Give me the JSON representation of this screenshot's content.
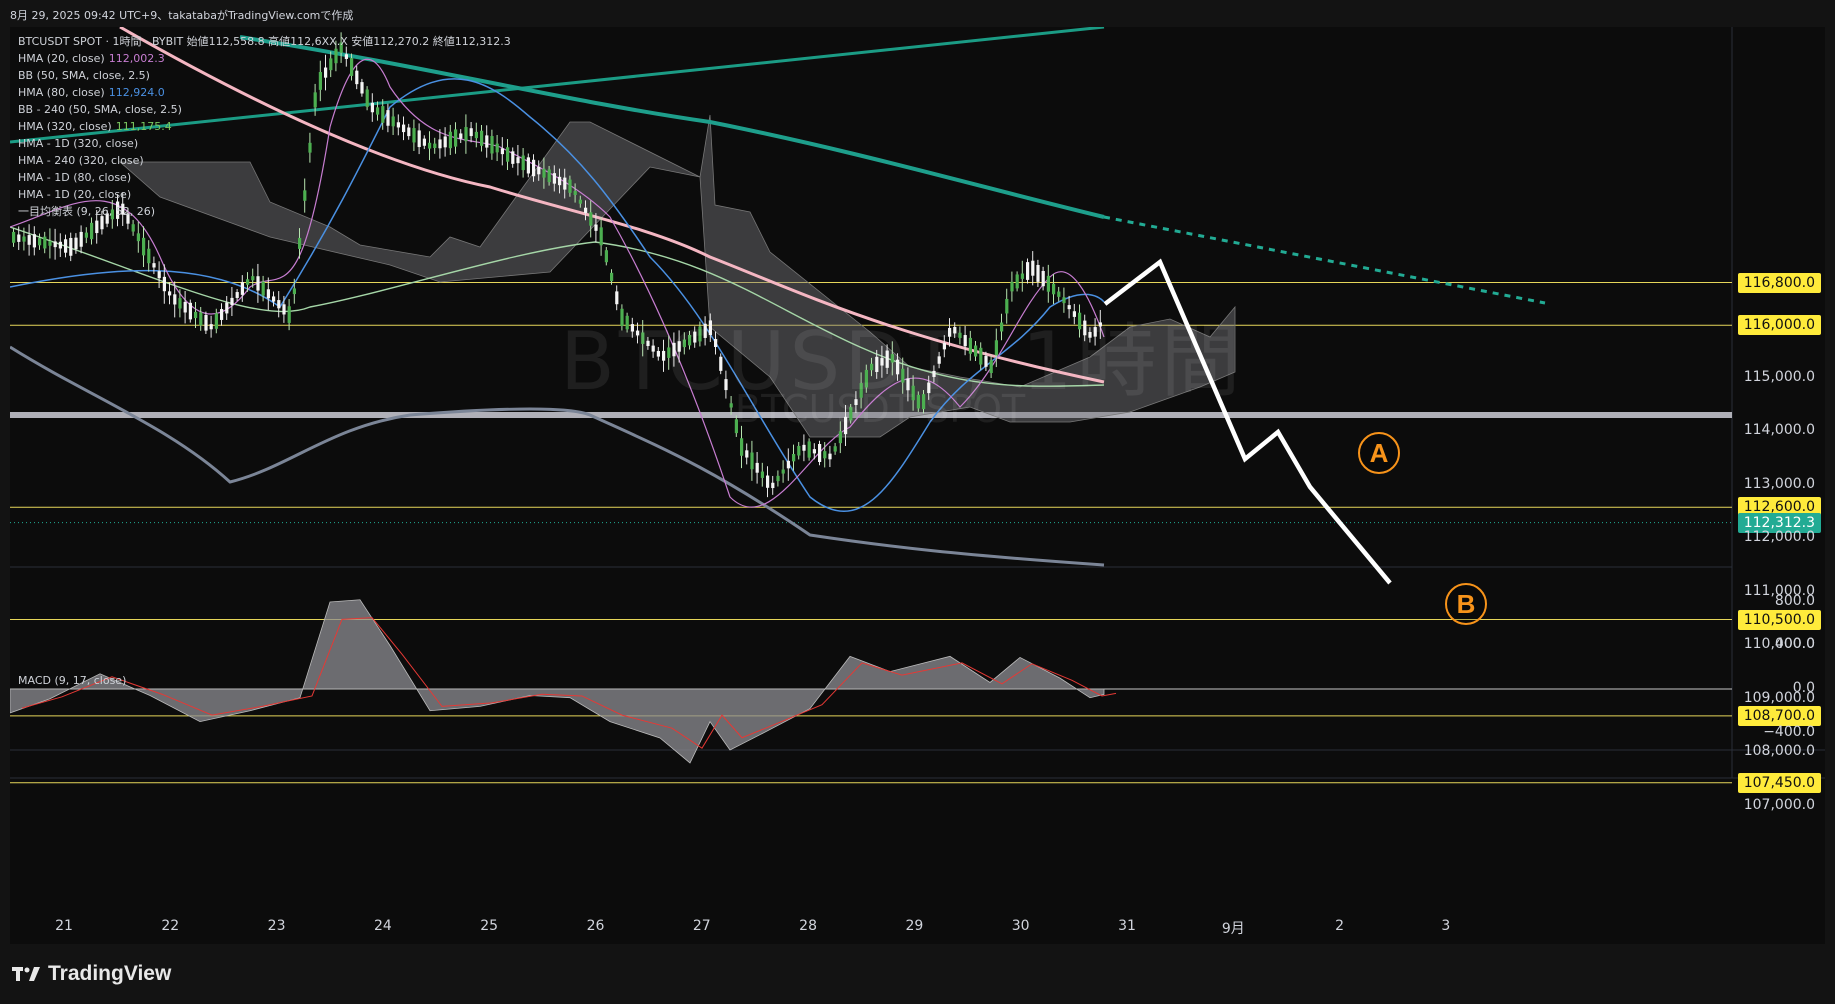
{
  "header": {
    "text": "8月 29, 2025 09:42 UTC+9、takatabaがTradingView.comで作成"
  },
  "legend": {
    "symbol": "BTCUSDT SPOT · 1時間 · BYBIT",
    "open_label": "始値",
    "open": "112,558.8",
    "high_label": "高値",
    "high": "112,6XX.X",
    "low_label": "安値",
    "low": "112,270.2",
    "close_label": "終値",
    "close": "112,312.3",
    "indicators": [
      {
        "label": "HMA (20, close)",
        "value": "112,002.3",
        "color": "#c77dd1"
      },
      {
        "label": "BB (50, SMA, close, 2.5)",
        "value": "",
        "color": "#cfd2d8"
      },
      {
        "label": "HMA (80, close)",
        "value": "112,924.0",
        "color": "#4a90e2"
      },
      {
        "label": "BB - 240 (50, SMA, close, 2.5)",
        "value": "",
        "color": "#cfd2d8"
      },
      {
        "label": "HMA (320, close)",
        "value": "111,175.4",
        "color": "#7ac860"
      },
      {
        "label": "HMA - 1D (320, close)",
        "value": "",
        "color": "#cfd2d8"
      },
      {
        "label": "HMA - 240 (320, close)",
        "value": "",
        "color": "#cfd2d8"
      },
      {
        "label": "HMA - 1D (80, close)",
        "value": "",
        "color": "#cfd2d8"
      },
      {
        "label": "HMA - 1D (20, close)",
        "value": "",
        "color": "#cfd2d8"
      },
      {
        "label": "一目均衡表 (9, 26, 52, 26)",
        "value": "",
        "color": "#cfd2d8"
      }
    ]
  },
  "watermark": {
    "main": "BTCUSDT, 1時間",
    "sub": "BTCUSDT SPOT"
  },
  "price_labels": [
    {
      "text": "116,800.0",
      "price": 116800,
      "style": "yel"
    },
    {
      "text": "116,000.0",
      "price": 116000,
      "style": "yel"
    },
    {
      "text": "115,000.0",
      "price": 115000,
      "style": "plain"
    },
    {
      "text": "114,000.0",
      "price": 114000,
      "style": "plain"
    },
    {
      "text": "113,000.0",
      "price": 113000,
      "style": "plain"
    },
    {
      "text": "112,600.0",
      "price": 112600,
      "style": "yel"
    },
    {
      "text": "112,312.3",
      "price": 112312.3,
      "style": "grn"
    },
    {
      "text": "112,000.0",
      "price": 112000,
      "style": "plain"
    },
    {
      "text": "111,000.0",
      "price": 111000,
      "style": "plain"
    },
    {
      "text": "110,500.0",
      "price": 110500,
      "style": "yel"
    },
    {
      "text": "110,000.0",
      "price": 110000,
      "style": "plain"
    },
    {
      "text": "109,000.0",
      "price": 109000,
      "style": "plain"
    },
    {
      "text": "108,700.0",
      "price": 108700,
      "style": "yel"
    },
    {
      "text": "108,000.0",
      "price": 108000,
      "style": "plain"
    },
    {
      "text": "107,450.0",
      "price": 107450,
      "style": "yel"
    },
    {
      "text": "107,000.0",
      "price": 107000,
      "style": "plain"
    }
  ],
  "macd": {
    "label": "MACD (9, 17, close)",
    "axis": [
      {
        "text": "800.0",
        "v": 800
      },
      {
        "text": "400.0",
        "v": 400
      },
      {
        "text": "0.0",
        "v": 0
      },
      {
        "text": "−400.0",
        "v": -400
      }
    ]
  },
  "x_axis": [
    "21",
    "22",
    "23",
    "24",
    "25",
    "26",
    "27",
    "28",
    "29",
    "30",
    "31",
    "9月",
    "2",
    "3"
  ],
  "forecast": {
    "point_a": "A",
    "point_b": "B"
  },
  "footer": {
    "brand": "TradingView"
  },
  "colors": {
    "accent": "#f7931a",
    "up": "#26a69a",
    "down": "#ef5350",
    "level": "#ffeb3b",
    "last_price": "#22ab94"
  }
}
